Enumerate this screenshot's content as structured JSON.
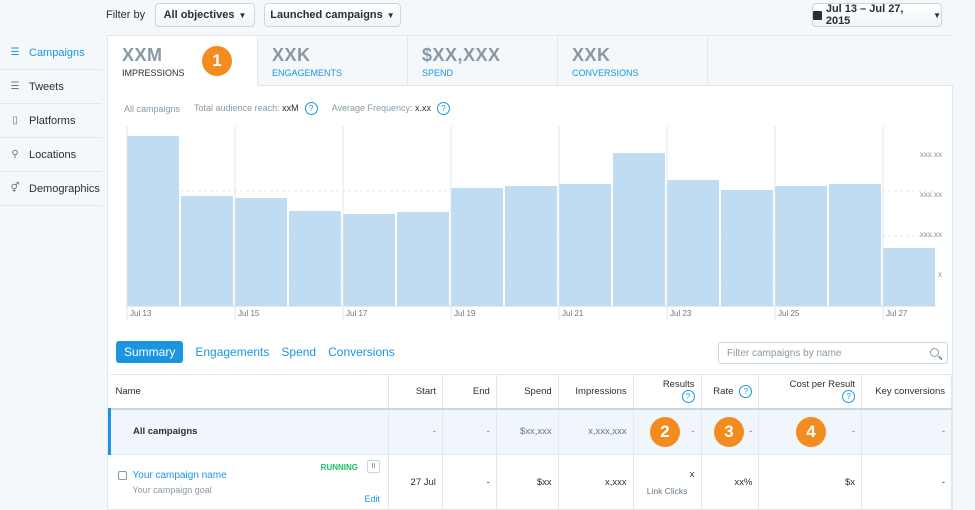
{
  "filter": {
    "label": "Filter by",
    "objectives": "All objectives",
    "campaigns": "Launched campaigns",
    "date_range": "Jul 13 – Jul 27, 2015"
  },
  "sidebar": {
    "items": [
      {
        "label": "Campaigns",
        "icon": "list-icon"
      },
      {
        "label": "Tweets",
        "icon": "list-icon"
      },
      {
        "label": "Platforms",
        "icon": "device-icon"
      },
      {
        "label": "Locations",
        "icon": "pin-icon"
      },
      {
        "label": "Demographics",
        "icon": "gender-icon"
      }
    ]
  },
  "metrics": [
    {
      "value": "XXM",
      "label": "IMPRESSIONS"
    },
    {
      "value": "XXK",
      "label": "ENGAGEMENTS"
    },
    {
      "value": "$XX,XXX",
      "label": "SPEND"
    },
    {
      "value": "XXK",
      "label": "CONVERSIONS"
    }
  ],
  "badges": [
    "1",
    "2",
    "3",
    "4"
  ],
  "stats": {
    "all_campaigns": "All campaigns",
    "reach_label": "Total audience reach:",
    "reach_value": "xxM",
    "freq_label": "Average Frequency:",
    "freq_value": "x.xx"
  },
  "chart_data": {
    "type": "bar",
    "categories": [
      "Jul 13",
      "Jul 14",
      "Jul 15",
      "Jul 16",
      "Jul 17",
      "Jul 18",
      "Jul 19",
      "Jul 20",
      "Jul 21",
      "Jul 22",
      "Jul 23",
      "Jul 24",
      "Jul 25",
      "Jul 26",
      "Jul 27"
    ],
    "x_tick_labels": [
      "Jul 13",
      "Jul 15",
      "Jul 17",
      "Jul 19",
      "Jul 21",
      "Jul 23",
      "Jul 25",
      "Jul 27"
    ],
    "values": [
      170,
      110,
      108,
      95,
      92,
      94,
      118,
      120,
      122,
      153,
      126,
      116,
      120,
      122,
      58
    ],
    "y_tick_labels": [
      "xxx.xx",
      "xxx.xx",
      "xxx.xx",
      "x"
    ],
    "ylim": [
      0,
      180
    ],
    "grid": true,
    "color": "#bfdcf2"
  },
  "sub_tabs": [
    "Summary",
    "Engagements",
    "Spend",
    "Conversions"
  ],
  "search": {
    "placeholder": "Filter campaigns by name"
  },
  "table": {
    "headers": [
      "Name",
      "Start",
      "End",
      "Spend",
      "Impressions",
      "Results",
      "Rate",
      "Cost per Result",
      "Key conversions"
    ],
    "all_row": [
      "All campaigns",
      "-",
      "-",
      "$xx,xxx",
      "x,xxx,xxx",
      "-",
      "-",
      "-",
      "-"
    ],
    "campaign": {
      "name": "Your campaign name",
      "goal": "Your campaign goal",
      "status": "RUNNING",
      "pause": "II",
      "edit": "Edit",
      "cells": [
        "27 Jul",
        "-",
        "$xx",
        "x,xxx",
        "x",
        "xx%",
        "$x",
        "-"
      ],
      "results_note": "Link Clicks"
    }
  },
  "colors": {
    "accent": "#1b95e0",
    "badge": "#f28c1f",
    "running": "#17bf63"
  }
}
